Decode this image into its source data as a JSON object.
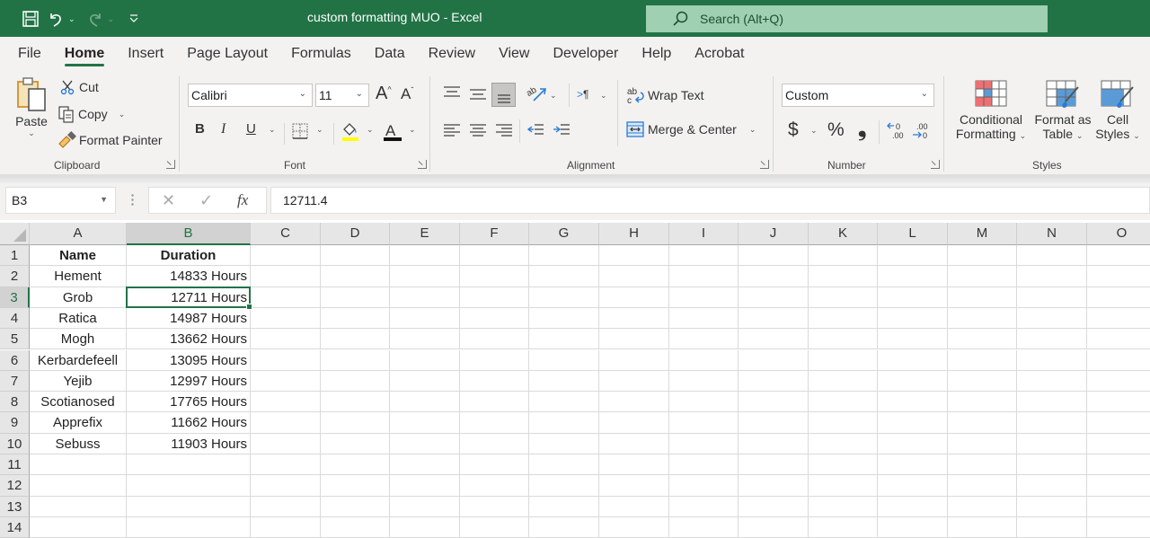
{
  "titlebar": {
    "title": "custom formatting MUO  -  Excel",
    "search_placeholder": "Search (Alt+Q)",
    "color": "#217346"
  },
  "tabs": [
    "File",
    "Home",
    "Insert",
    "Page Layout",
    "Formulas",
    "Data",
    "Review",
    "View",
    "Developer",
    "Help",
    "Acrobat"
  ],
  "active_tab": "Home",
  "ribbon": {
    "clipboard": {
      "label": "Clipboard",
      "paste": "Paste",
      "cut": "Cut",
      "copy": "Copy",
      "format_painter": "Format Painter"
    },
    "font": {
      "label": "Font",
      "font_name": "Calibri",
      "font_size": "11",
      "bold": "B",
      "italic": "I",
      "underline": "U"
    },
    "alignment": {
      "label": "Alignment",
      "wrap_text": "Wrap Text",
      "merge_center": "Merge & Center"
    },
    "number": {
      "label": "Number",
      "format": "Custom",
      "currency": "$",
      "percent": "%",
      "comma": "❟"
    },
    "styles": {
      "label": "Styles",
      "conditional_1": "Conditional",
      "conditional_2": "Formatting",
      "format_table_1": "Format as",
      "format_table_2": "Table",
      "cell_styles_1": "Cell",
      "cell_styles_2": "Styles"
    }
  },
  "formula_bar": {
    "name_box": "B3",
    "value": "12711.4",
    "fx": "fx"
  },
  "grid": {
    "columns": [
      "A",
      "B",
      "C",
      "D",
      "E",
      "F",
      "G",
      "H",
      "I",
      "J",
      "K",
      "L",
      "M",
      "N",
      "O"
    ],
    "rows": [
      "1",
      "2",
      "3",
      "4",
      "5",
      "6",
      "7",
      "8",
      "9",
      "10",
      "11",
      "12",
      "13",
      "14"
    ],
    "selected_cell": "B3",
    "header": [
      "Name",
      "Duration"
    ],
    "data": [
      [
        "Hement",
        "14833 Hours"
      ],
      [
        "Grob",
        "12711 Hours"
      ],
      [
        "Ratica",
        "14987 Hours"
      ],
      [
        "Mogh",
        "13662 Hours"
      ],
      [
        "Kerbardefeell",
        "13095 Hours"
      ],
      [
        "Yejib",
        "12997 Hours"
      ],
      [
        "Scotianosed",
        "17765 Hours"
      ],
      [
        "Apprefix",
        "11662 Hours"
      ],
      [
        "Sebuss",
        "11903 Hours"
      ]
    ]
  }
}
